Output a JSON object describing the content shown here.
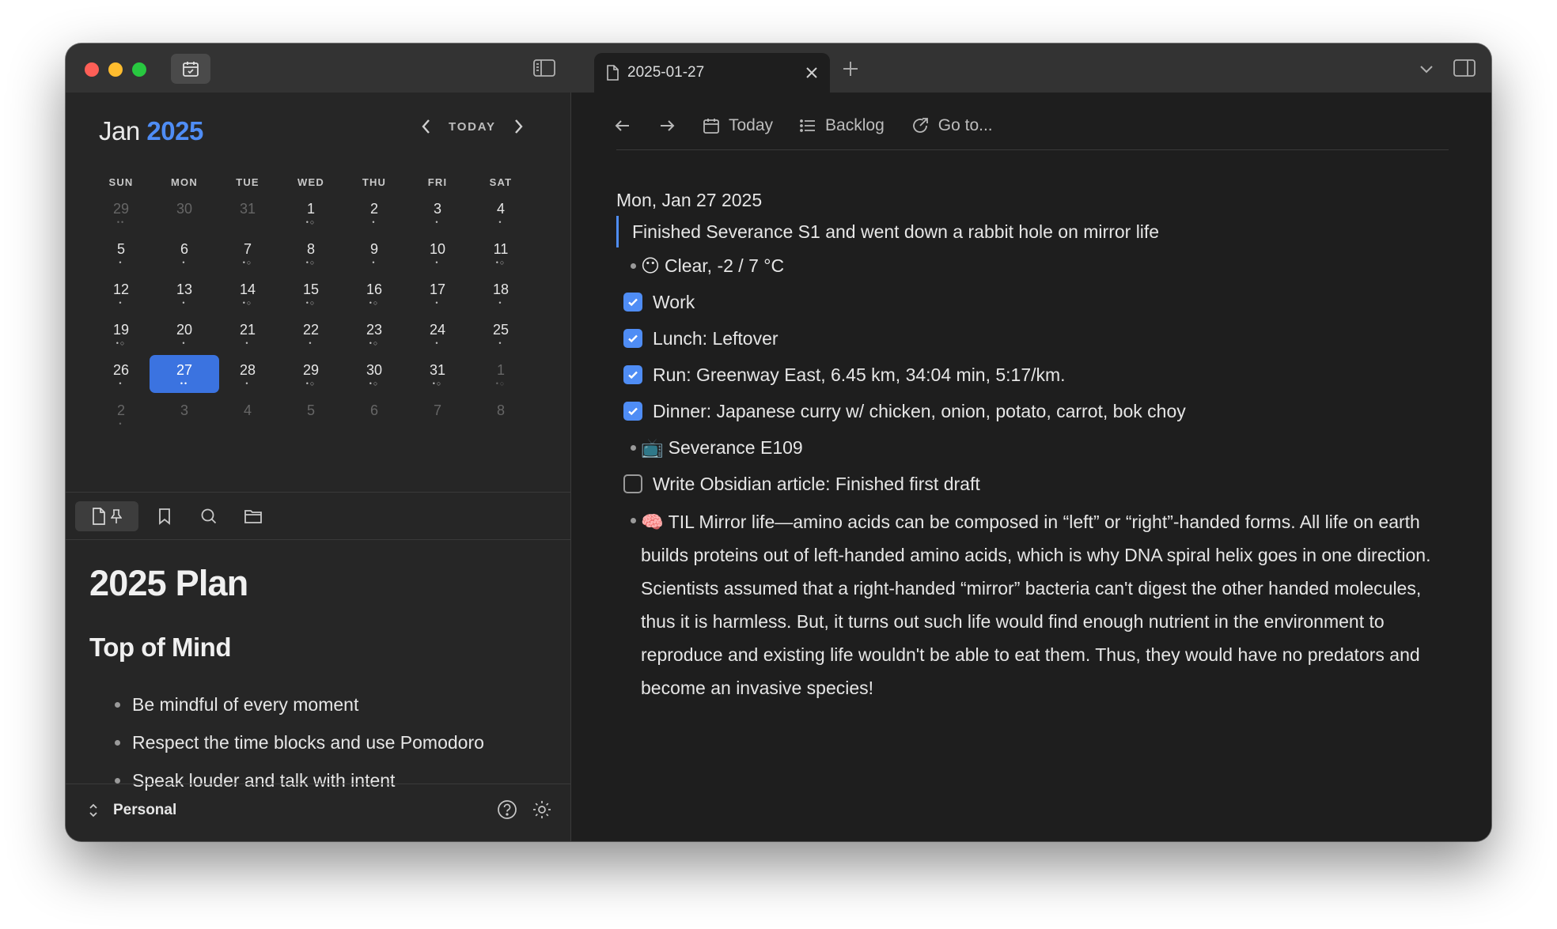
{
  "tab": {
    "title": "2025-01-27"
  },
  "calendar": {
    "month": "Jan",
    "year": "2025",
    "today_label": "TODAY",
    "weekdays": [
      "SUN",
      "MON",
      "TUE",
      "WED",
      "THU",
      "FRI",
      "SAT"
    ],
    "weeks": [
      [
        {
          "d": "29",
          "m": true,
          "dots": "••"
        },
        {
          "d": "30",
          "m": true,
          "dots": ""
        },
        {
          "d": "31",
          "m": true,
          "dots": ""
        },
        {
          "d": "1",
          "dots": "•○"
        },
        {
          "d": "2",
          "dots": "•"
        },
        {
          "d": "3",
          "dots": "•"
        },
        {
          "d": "4",
          "dots": "•"
        }
      ],
      [
        {
          "d": "5",
          "dots": "•"
        },
        {
          "d": "6",
          "dots": "•"
        },
        {
          "d": "7",
          "dots": "•○"
        },
        {
          "d": "8",
          "dots": "•○"
        },
        {
          "d": "9",
          "dots": "•"
        },
        {
          "d": "10",
          "dots": "•"
        },
        {
          "d": "11",
          "dots": "•○"
        }
      ],
      [
        {
          "d": "12",
          "dots": "•"
        },
        {
          "d": "13",
          "dots": "•"
        },
        {
          "d": "14",
          "dots": "•○"
        },
        {
          "d": "15",
          "dots": "•○"
        },
        {
          "d": "16",
          "dots": "•○"
        },
        {
          "d": "17",
          "dots": "•"
        },
        {
          "d": "18",
          "dots": "•"
        }
      ],
      [
        {
          "d": "19",
          "dots": "•○"
        },
        {
          "d": "20",
          "dots": "•"
        },
        {
          "d": "21",
          "dots": "•"
        },
        {
          "d": "22",
          "dots": "•"
        },
        {
          "d": "23",
          "dots": "•○"
        },
        {
          "d": "24",
          "dots": "•"
        },
        {
          "d": "25",
          "dots": "•"
        }
      ],
      [
        {
          "d": "26",
          "dots": "•"
        },
        {
          "d": "27",
          "sel": true,
          "dots": "••"
        },
        {
          "d": "28",
          "dots": "•"
        },
        {
          "d": "29",
          "dots": "•○"
        },
        {
          "d": "30",
          "dots": "•○"
        },
        {
          "d": "31",
          "dots": "•○"
        },
        {
          "d": "1",
          "m": true,
          "dots": "•○"
        }
      ],
      [
        {
          "d": "2",
          "m": true,
          "dots": "•"
        },
        {
          "d": "3",
          "m": true,
          "dots": ""
        },
        {
          "d": "4",
          "m": true,
          "dots": ""
        },
        {
          "d": "5",
          "m": true,
          "dots": ""
        },
        {
          "d": "6",
          "m": true,
          "dots": ""
        },
        {
          "d": "7",
          "m": true,
          "dots": ""
        },
        {
          "d": "8",
          "m": true,
          "dots": ""
        }
      ]
    ]
  },
  "note": {
    "title": "2025 Plan",
    "subtitle": "Top of Mind",
    "items": [
      "Be mindful of every moment",
      "Respect the time blocks and use Pomodoro",
      "Speak louder and talk with intent"
    ]
  },
  "footer": {
    "vault": "Personal"
  },
  "toolbar": {
    "today": "Today",
    "backlog": "Backlog",
    "goto": "Go to..."
  },
  "journal": {
    "date": "Mon, Jan 27 2025",
    "quote": "Finished Severance S1 and went down a rabbit hole on mirror life",
    "weather_emoji": "😶",
    "weather": "Clear, -2 / 7 °C",
    "tasks": [
      {
        "text": "Work",
        "checked": true
      },
      {
        "text": "Lunch: Leftover",
        "checked": true
      },
      {
        "text": "Run: Greenway East, 6.45 km, 34:04 min, 5:17/km.",
        "checked": true
      },
      {
        "text": "Dinner: Japanese curry w/ chicken, onion, potato, carrot, bok choy",
        "checked": true
      }
    ],
    "tv_emoji": "📺",
    "tv": "Severance E109",
    "todo": "Write Obsidian article: Finished first draft",
    "til_emoji": "🧠",
    "til": "TIL Mirror life—amino acids can be composed in “left” or “right”-handed forms. All life on earth builds proteins out of left-handed amino acids, which is why DNA spiral helix goes in one direction. Scientists assumed that a right-handed “mirror” bacteria can't digest the other handed molecules, thus it is harmless. But, it turns out such life would find enough nutrient in the environment to reproduce and existing life wouldn't be able to eat them. Thus, they would have no predators and become an invasive species!"
  }
}
